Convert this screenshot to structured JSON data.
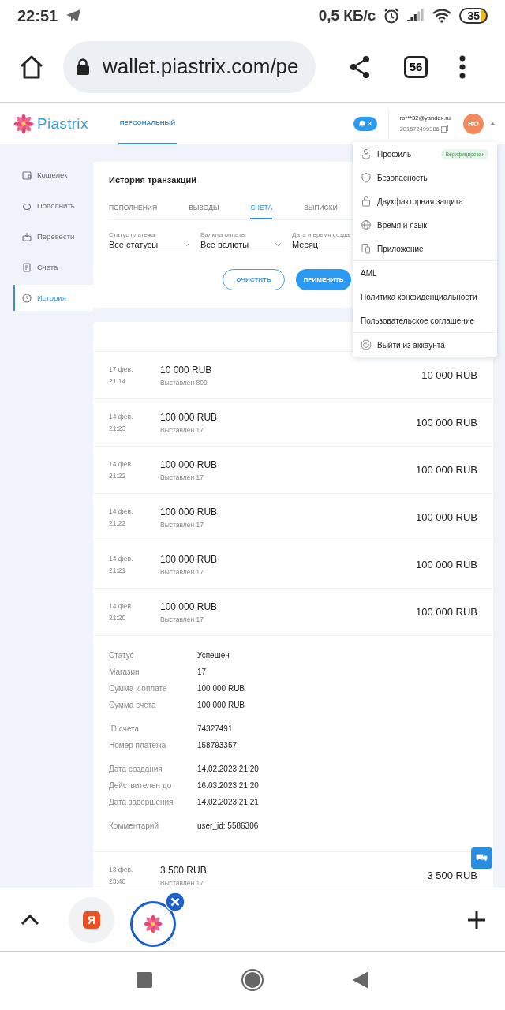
{
  "status_bar": {
    "time": "22:51",
    "speed": "0,5 КБ/с",
    "battery": "35"
  },
  "browser": {
    "url": "wallet.piastrix.com/pe",
    "tab_count": "56"
  },
  "header": {
    "logo": "Piastrix",
    "nav": [
      {
        "label": "ПЕРСОНАЛЬНЫЙ",
        "selected": true
      }
    ],
    "notifications": "3",
    "email": "ro***32@yandex.ru",
    "account": "201572499386",
    "avatar": "RO"
  },
  "sidebar": {
    "items": [
      {
        "label": "Кошелек",
        "selected": false
      },
      {
        "label": "Пополнить",
        "selected": false
      },
      {
        "label": "Перевести",
        "selected": false
      },
      {
        "label": "Счета",
        "selected": false
      },
      {
        "label": "История",
        "selected": true
      }
    ]
  },
  "history": {
    "title": "История транзакций",
    "tabs": [
      {
        "label": "ПОПОЛНЕНИЯ",
        "selected": false
      },
      {
        "label": "ВЫВОДЫ",
        "selected": false
      },
      {
        "label": "СЧЕТА",
        "selected": true
      },
      {
        "label": "ВЫПИСКИ",
        "selected": false
      }
    ],
    "filters": [
      {
        "label": "Статус платежа",
        "value": "Все статусы"
      },
      {
        "label": "Валюта оплаты",
        "value": "Все валюты"
      },
      {
        "label": "Дата и время созда",
        "value": "Месяц"
      }
    ],
    "buttons": [
      {
        "label": "ОЧИСТИТЬ",
        "kind": "outline"
      },
      {
        "label": "ПРИМЕНИТЬ",
        "kind": "primary"
      }
    ]
  },
  "invoices": {
    "rows": [
      {
        "date": "17 фев.",
        "time": "21:14",
        "amount": "10 000 RUB",
        "subtitle": "Выставлен 809",
        "total": "10 000 RUB"
      },
      {
        "date": "14 фев.",
        "time": "21:23",
        "amount": "100 000 RUB",
        "subtitle": "Выставлен 17",
        "total": "100 000 RUB"
      },
      {
        "date": "14 фев.",
        "time": "21:22",
        "amount": "100 000 RUB",
        "subtitle": "Выставлен 17",
        "total": "100 000 RUB"
      },
      {
        "date": "14 фев.",
        "time": "21:22",
        "amount": "100 000 RUB",
        "subtitle": "Выставлен 17",
        "total": "100 000 RUB"
      },
      {
        "date": "14 фев.",
        "time": "21:21",
        "amount": "100 000 RUB",
        "subtitle": "Выставлен 17",
        "total": "100 000 RUB"
      },
      {
        "date": "14 фев.",
        "time": "21:20",
        "amount": "100 000 RUB",
        "subtitle": "Выставлен 17",
        "total": "100 000 RUB",
        "details": [
          [
            {
              "label": "Статус",
              "value": "Успешен"
            },
            {
              "label": "Магазин",
              "value": "17"
            },
            {
              "label": "Сумма к оплате",
              "value": "100 000 RUB"
            },
            {
              "label": "Сумма счета",
              "value": "100 000 RUB"
            }
          ],
          [
            {
              "label": "ID счета",
              "value": "74327491"
            },
            {
              "label": "Номер платежа",
              "value": "158793357"
            }
          ],
          [
            {
              "label": "Дата создания",
              "value": "14.02.2023 21:20"
            },
            {
              "label": "Действителен до",
              "value": "16.03.2023 21:20"
            },
            {
              "label": "Дата завершения",
              "value": "14.02.2023 21:21"
            }
          ],
          [
            {
              "label": "Комментарий",
              "value": "user_id: 5586306"
            }
          ]
        ]
      },
      {
        "date": "13 фев.",
        "time": "23:40",
        "amount": "3 500 RUB",
        "subtitle": "Выставлен 17",
        "total": "3 500 RUB"
      }
    ]
  },
  "menu": {
    "groups": [
      [
        {
          "label": "Профиль",
          "kind": "icon",
          "badge": "Верифицирован"
        },
        {
          "label": "Безопасность",
          "kind": "icon"
        },
        {
          "label": "Двухфакторная защита",
          "kind": "icon"
        },
        {
          "label": "Время и язык",
          "kind": "icon"
        },
        {
          "label": "Приложение",
          "kind": "icon"
        }
      ],
      [
        {
          "label": "AML",
          "kind": "plain"
        },
        {
          "label": "Политика конфиденциальности",
          "kind": "plain"
        },
        {
          "label": "Пользовательское соглашение",
          "kind": "plain"
        }
      ],
      [
        {
          "label": "Выйти из аккаунта",
          "kind": "icon"
        }
      ]
    ]
  },
  "tab_strip": {
    "tabs": [
      {
        "label": "Я",
        "selected": false
      },
      {
        "selected": true
      }
    ]
  }
}
